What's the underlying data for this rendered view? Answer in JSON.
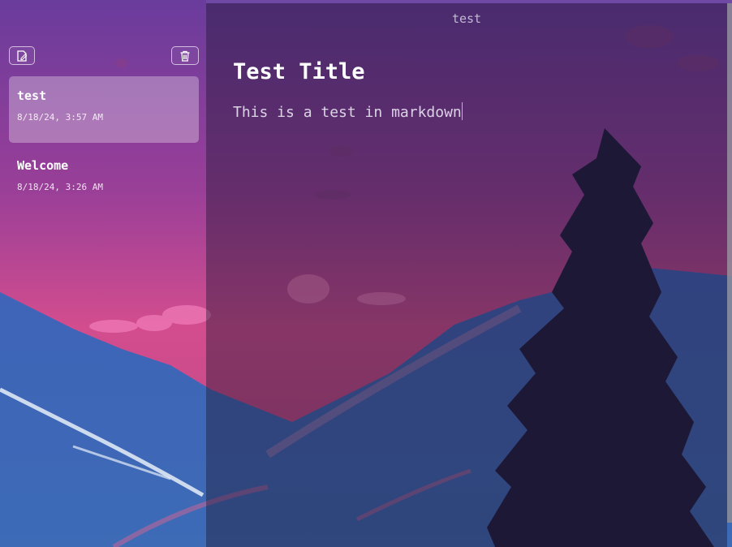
{
  "window": {
    "title": "test"
  },
  "toolbar": {
    "new_note_icon": "compose-icon",
    "delete_icon": "trash-icon"
  },
  "notes": [
    {
      "title": "test",
      "date": "8/18/24, 3:57 AM",
      "selected": true
    },
    {
      "title": "Welcome",
      "date": "8/18/24, 3:26 AM",
      "selected": false
    }
  ],
  "editor": {
    "heading": "Test Title",
    "body": "This is a test in markdown"
  },
  "colors": {
    "caret": "#e9b44c",
    "accent": "#8a4fb0"
  }
}
